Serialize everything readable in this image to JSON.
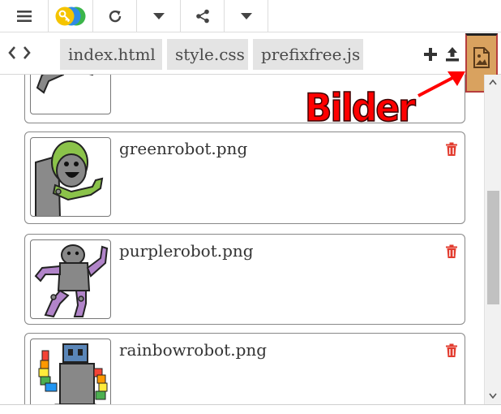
{
  "toolbar": {
    "menu_icon": "hamburger-menu-icon",
    "key_icon": "key-icon",
    "refresh_icon": "refresh-icon",
    "dropdown_icon": "chevron-down-icon",
    "share_icon": "share-icon",
    "brand_colors": [
      "#f5c400",
      "#2e8be6",
      "#3bb54a"
    ]
  },
  "tabs": {
    "items": [
      {
        "label": "index.html"
      },
      {
        "label": "style.css"
      },
      {
        "label": "prefixfree.js"
      }
    ],
    "actions": {
      "add_icon": "plus-icon",
      "upload_icon": "upload-icon",
      "images_icon": "image-file-icon"
    }
  },
  "assets": {
    "files": [
      {
        "name": "greenrobot.png"
      },
      {
        "name": "purplerobot.png"
      },
      {
        "name": "rainbowrobot.png"
      }
    ],
    "delete_icon": "trash-icon",
    "delete_color": "#e23b2e"
  },
  "annotation": {
    "label": "Bilder",
    "color": "#ff0000"
  }
}
